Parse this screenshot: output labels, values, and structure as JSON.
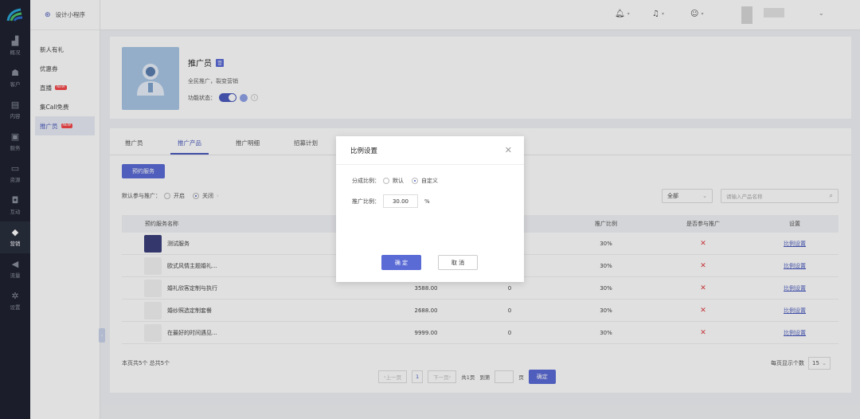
{
  "rail": {
    "items": [
      {
        "label": "概况",
        "icon": "chart-icon"
      },
      {
        "label": "客户",
        "icon": "users-icon"
      },
      {
        "label": "内容",
        "icon": "document-icon"
      },
      {
        "label": "服务",
        "icon": "service-icon"
      },
      {
        "label": "资源",
        "icon": "monitor-icon"
      },
      {
        "label": "互动",
        "icon": "gamepad-icon"
      },
      {
        "label": "营销",
        "icon": "tag-icon"
      },
      {
        "label": "流量",
        "icon": "megaphone-icon"
      },
      {
        "label": "设置",
        "icon": "gear-icon"
      }
    ]
  },
  "sidebar": {
    "app_name": "设计小程序",
    "items": [
      {
        "label": "新人有礼",
        "tag": ""
      },
      {
        "label": "优惠券",
        "tag": ""
      },
      {
        "label": "直播",
        "tag": "NEW"
      },
      {
        "label": "集Call免费",
        "tag": ""
      },
      {
        "label": "推广员",
        "tag": "NEW"
      }
    ]
  },
  "profile": {
    "title": "推广员",
    "badge": "营",
    "description": "全民推广，裂变营销",
    "status_label": "功能状态："
  },
  "tabs": [
    "推广员",
    "推广产品",
    "推广明细",
    "招募计划"
  ],
  "toolbar": {
    "book_button": "预约服务",
    "filter_label": "默认参与推广：",
    "option_on": "开启",
    "option_off": "关闭",
    "select_value": "全部",
    "search_placeholder": "请输入产品名称"
  },
  "table": {
    "headers": {
      "name": "预约服务名称",
      "rate": "推广比例",
      "join": "是否参与推广",
      "setting": "设置"
    },
    "rows": [
      {
        "name": "测试服务",
        "price": "",
        "sales": "",
        "rate": "30%",
        "join": "✕",
        "setting": "比例设置"
      },
      {
        "name": "欧式风情主题婚礼...",
        "price": "",
        "sales": "",
        "rate": "30%",
        "join": "✕",
        "setting": "比例设置"
      },
      {
        "name": "婚礼欣客定制与执行",
        "price": "3588.00",
        "sales": "0",
        "rate": "30%",
        "join": "✕",
        "setting": "比例设置"
      },
      {
        "name": "婚纱照选定制套餐",
        "price": "2688.00",
        "sales": "0",
        "rate": "30%",
        "join": "✕",
        "setting": "比例设置"
      },
      {
        "name": "在最好的时间遇见...",
        "price": "9999.00",
        "sales": "0",
        "rate": "30%",
        "join": "✕",
        "setting": "比例设置"
      }
    ]
  },
  "pagination": {
    "summary": "本页共5个  总共5个",
    "prev": "上一页",
    "current": "1",
    "next": "下一页",
    "total_pages": "共1页",
    "goto_label": "到第",
    "page_unit": "页",
    "confirm": "确定",
    "per_page_label": "每页显示个数",
    "per_page_value": "15"
  },
  "modal": {
    "title": "比例设置",
    "split_label": "分成比例：",
    "option_default": "默认",
    "option_custom": "自定义",
    "rate_label": "推广比例：",
    "rate_value": "30.00",
    "unit": "%",
    "confirm": "确 定",
    "cancel": "取 消"
  },
  "colors": {
    "accent": "#5b6bd6",
    "rail_bg": "#1f2330",
    "error": "#e0393e"
  }
}
